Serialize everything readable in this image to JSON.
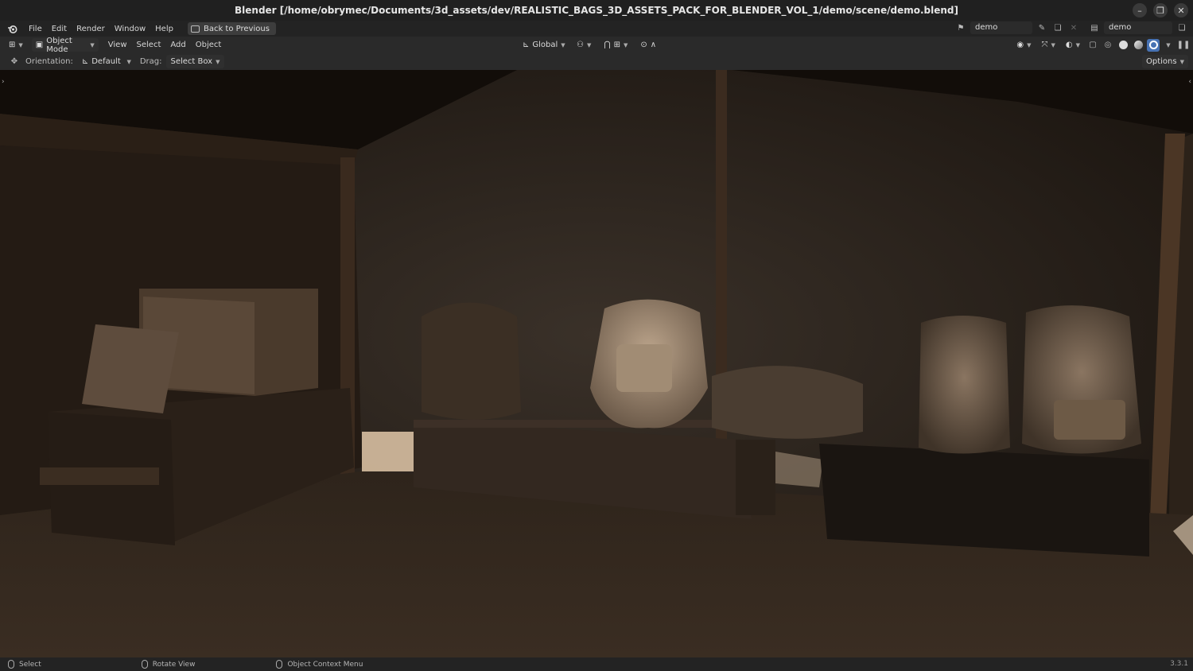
{
  "window": {
    "title": "Blender [/home/obrymec/Documents/3d_assets/dev/REALISTIC_BAGS_3D_ASSETS_PACK_FOR_BLENDER_VOL_1/demo/scene/demo.blend]",
    "minimize_icon": "minimize-icon",
    "maximize_icon": "restore-icon",
    "close_icon": "close-icon"
  },
  "topbar": {
    "menus": [
      "File",
      "Edit",
      "Render",
      "Window",
      "Help"
    ],
    "back_button": "Back to Previous",
    "scene_name": "demo",
    "view_layer_name": "demo"
  },
  "header": {
    "mode": "Object Mode",
    "menus": [
      "View",
      "Select",
      "Add",
      "Object"
    ],
    "transform_orientation": "Global"
  },
  "tool_settings": {
    "orientation_label": "Orientation:",
    "orientation_value": "Default",
    "drag_label": "Drag:",
    "drag_value": "Select Box",
    "options_label": "Options"
  },
  "statusbar": {
    "select": "Select",
    "rotate": "Rotate View",
    "context_menu": "Object Context Menu",
    "version": "3.3.1"
  },
  "colors": {
    "accent": "#4772b3",
    "bg": "#1d1d1d"
  }
}
